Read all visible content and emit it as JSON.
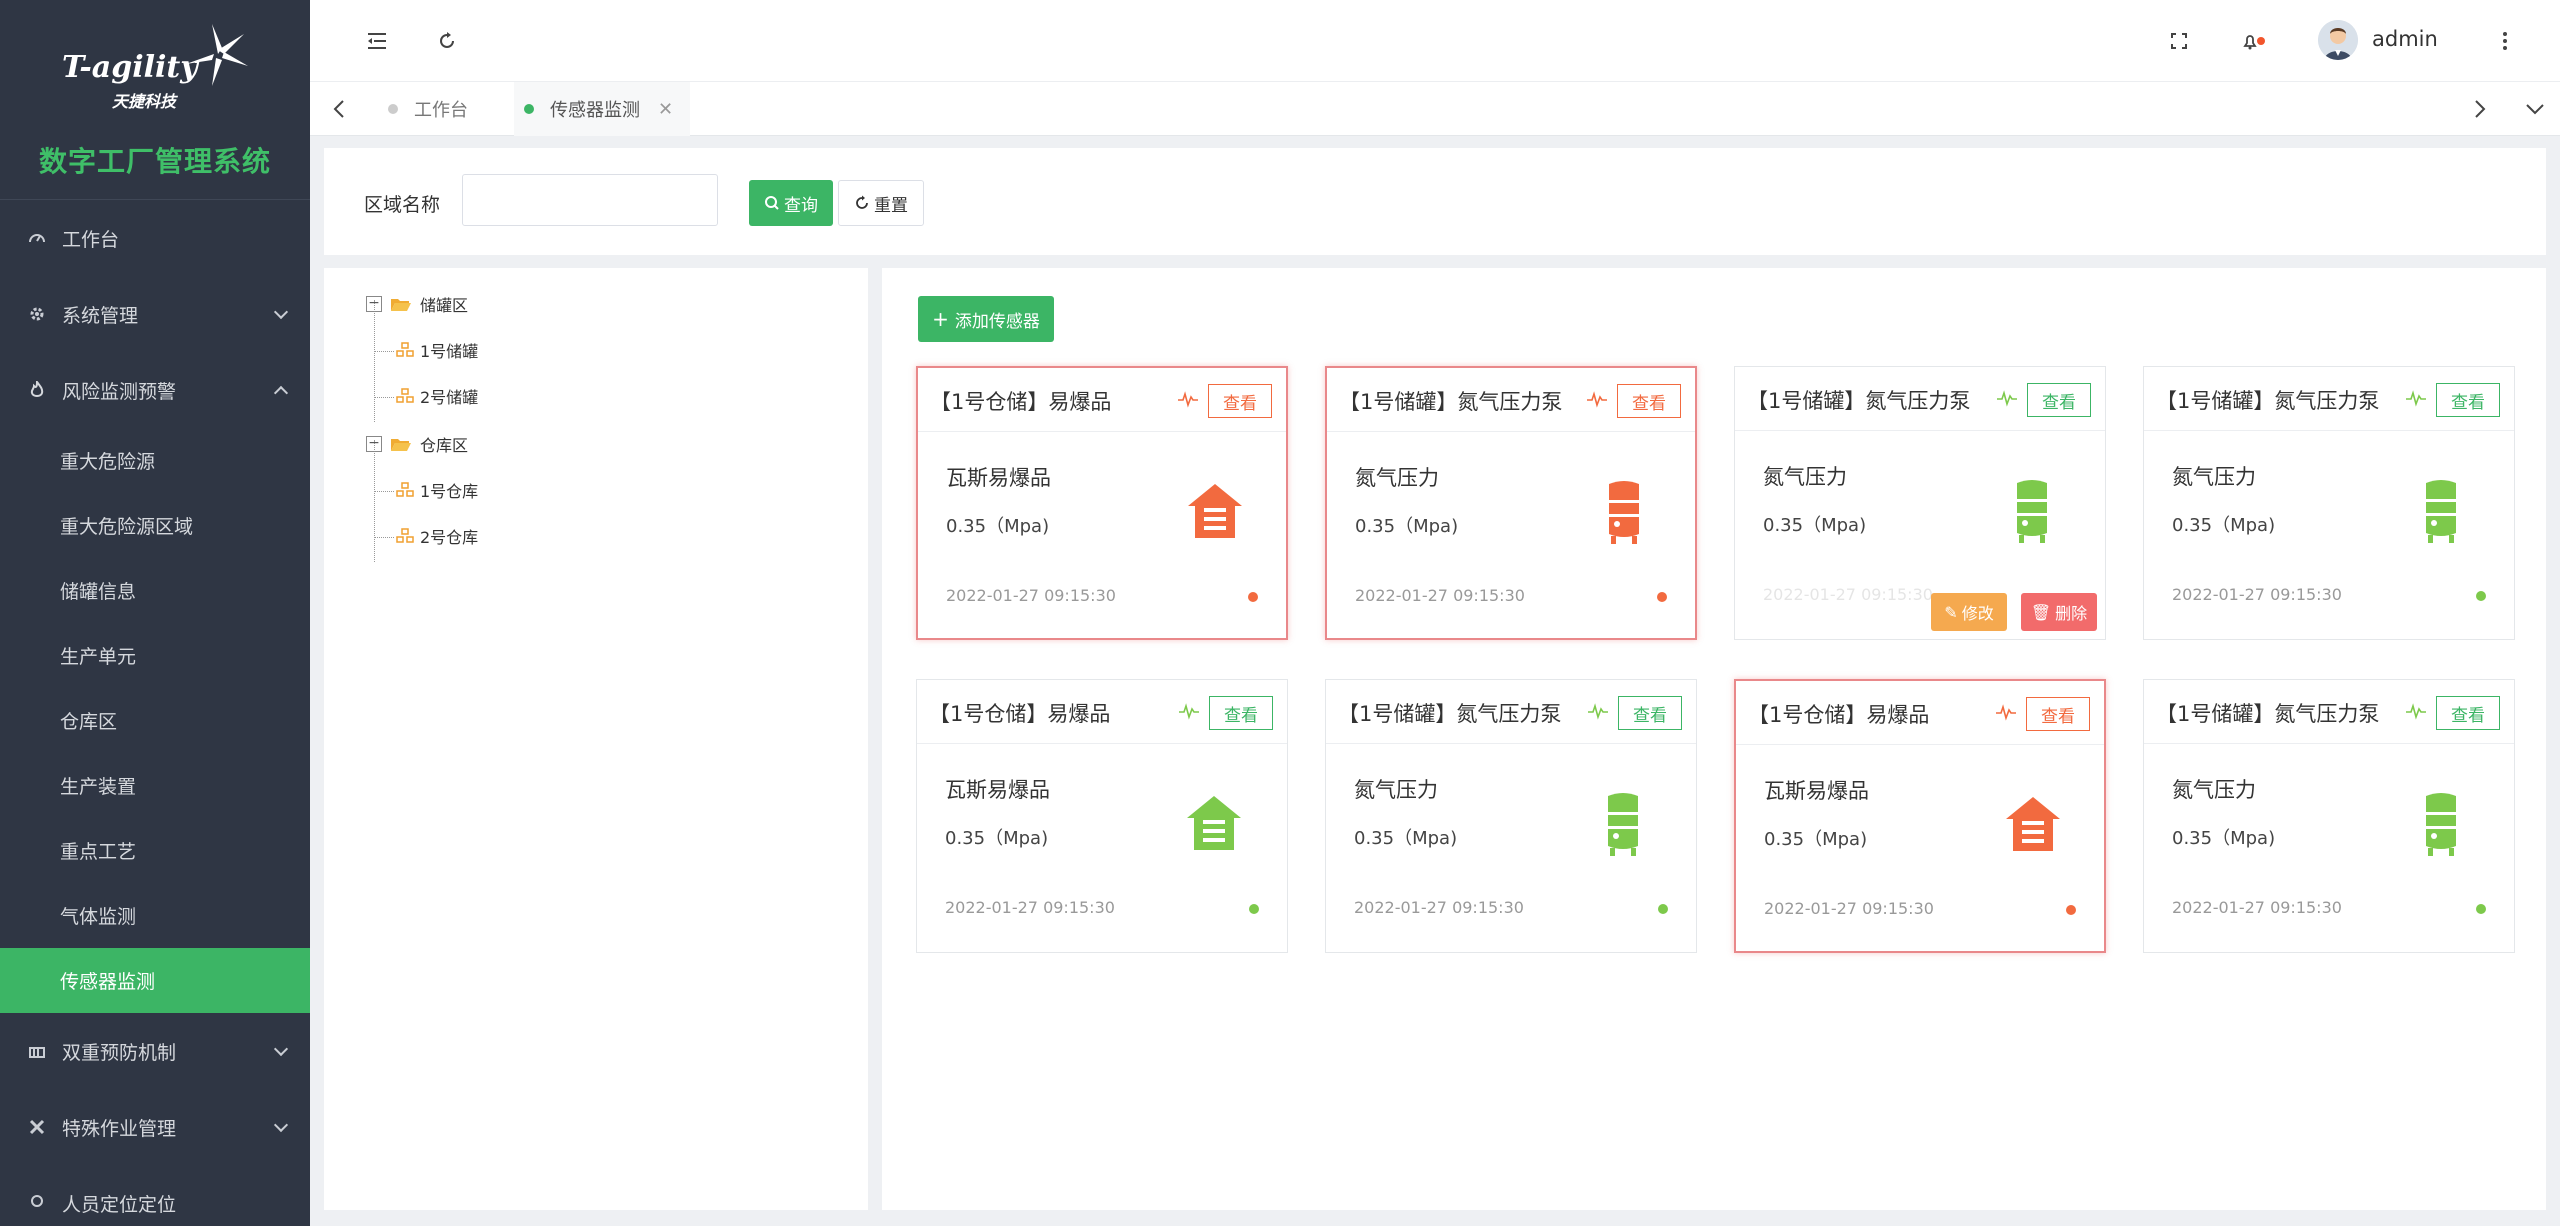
{
  "logo": {
    "brand": "T-agility",
    "brand_cn": "天捷科技",
    "system_title": "数字工厂管理系统"
  },
  "sidebar": {
    "items": [
      {
        "label": "工作台",
        "icon": "dashboard-icon"
      },
      {
        "label": "系统管理",
        "icon": "gear-icon"
      },
      {
        "label": "风险监测预警",
        "icon": "fire-icon",
        "expanded": true,
        "children": [
          "重大危险源",
          "重大危险源区域",
          "储罐信息",
          "生产单元",
          "仓库区",
          "生产装置",
          "重点工艺",
          "气体监测",
          "传感器监测"
        ],
        "active_child": "传感器监测"
      },
      {
        "label": "双重预防机制",
        "icon": "building-icon"
      },
      {
        "label": "特殊作业管理",
        "icon": "tools-icon"
      },
      {
        "label": "人员定位定位",
        "icon": "location-icon"
      }
    ]
  },
  "header": {
    "user": "admin"
  },
  "tabs": [
    {
      "label": "工作台",
      "active": false
    },
    {
      "label": "传感器监测",
      "active": true
    }
  ],
  "search": {
    "label": "区域名称",
    "value": "",
    "placeholder": "",
    "query_label": "查询",
    "reset_label": "重置"
  },
  "tree": [
    {
      "label": "储罐区",
      "children": [
        "1号储罐",
        "2号储罐"
      ]
    },
    {
      "label": "仓库区",
      "children": [
        "1号仓库",
        "2号仓库"
      ]
    }
  ],
  "add_button": "添加传感器",
  "colors": {
    "green": "#3cb565",
    "alert": "#f26a3f",
    "ok": "#7dc94b"
  },
  "cards": [
    {
      "title": "【1号仓储】易爆品",
      "name": "瓦斯易爆品",
      "value": "0.35（Mpa)",
      "time": "2022-01-27 09:15:30",
      "view": "查看",
      "status": "alert",
      "icon": "warehouse-icon"
    },
    {
      "title": "【1号储罐】氮气压力泵",
      "name": "氮气压力",
      "value": "0.35（Mpa)",
      "time": "2022-01-27 09:15:30",
      "view": "查看",
      "status": "alert",
      "icon": "tank-icon"
    },
    {
      "title": "【1号储罐】氮气压力泵",
      "name": "氮气压力",
      "value": "0.35（Mpa)",
      "time": "2022-01-27 09:15:30",
      "view": "查看",
      "status": "ok",
      "icon": "tank-icon",
      "hover": true,
      "edit": "修改",
      "delete": "删除"
    },
    {
      "title": "【1号储罐】氮气压力泵",
      "name": "氮气压力",
      "value": "0.35（Mpa)",
      "time": "2022-01-27 09:15:30",
      "view": "查看",
      "status": "ok",
      "icon": "tank-icon"
    },
    {
      "title": "【1号仓储】易爆品",
      "name": "瓦斯易爆品",
      "value": "0.35（Mpa)",
      "time": "2022-01-27 09:15:30",
      "view": "查看",
      "status": "ok",
      "icon": "warehouse-icon"
    },
    {
      "title": "【1号储罐】氮气压力泵",
      "name": "氮气压力",
      "value": "0.35（Mpa)",
      "time": "2022-01-27 09:15:30",
      "view": "查看",
      "status": "ok",
      "icon": "tank-icon"
    },
    {
      "title": "【1号仓储】易爆品",
      "name": "瓦斯易爆品",
      "value": "0.35（Mpa)",
      "time": "2022-01-27 09:15:30",
      "view": "查看",
      "status": "alert",
      "icon": "warehouse-icon"
    },
    {
      "title": "【1号储罐】氮气压力泵",
      "name": "氮气压力",
      "value": "0.35（Mpa)",
      "time": "2022-01-27 09:15:30",
      "view": "查看",
      "status": "ok",
      "icon": "tank-icon"
    }
  ]
}
